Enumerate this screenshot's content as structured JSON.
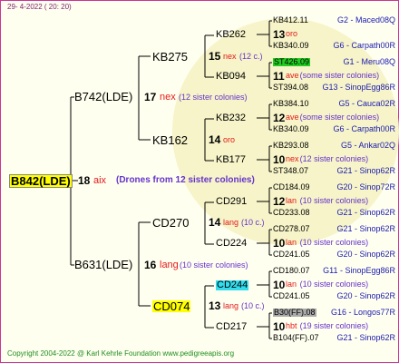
{
  "date": "29-  4-2022 ( 20: 20)",
  "root": {
    "name": "B842(LDE)",
    "num": "18",
    "race": "aix",
    "note": "(Drones from 12 sister colonies)"
  },
  "gen1": [
    {
      "name": "B742(LDE)",
      "num": "17",
      "race": "nex",
      "note": "(12 sister colonies)"
    },
    {
      "name": "B631(LDE)",
      "num": "16",
      "race": "lang",
      "note": "(10 sister colonies)"
    }
  ],
  "gen2": [
    {
      "name": "KB275",
      "num": "15",
      "race": "nex",
      "note": "(12 c.)"
    },
    {
      "name": "KB162",
      "num": "14",
      "race": "oro",
      "note": ""
    },
    {
      "name": "CD270",
      "num": "14",
      "race": "lang",
      "note": "(10 c.)"
    },
    {
      "name": "CD074",
      "num": "13",
      "race": "lang",
      "note": "(10 c.)"
    }
  ],
  "gen3": [
    "KB262",
    "KB094",
    "KB232",
    "KB177",
    "CD291",
    "CD224",
    "CD244",
    "CD217"
  ],
  "leaves": [
    {
      "top": "KB412.11",
      "topInfo": "G2 - Maced08Q",
      "mid": "13",
      "midRace": "oro",
      "midNote": "",
      "bot": "KB340.09",
      "botInfo": "G6 - Carpath00R"
    },
    {
      "top": "ST426.09",
      "topInfo": "G1 - Meru08Q",
      "mid": "11",
      "midRace": "ave",
      "midNote": "(some sister colonies)",
      "bot": "ST394.08",
      "botInfo": "G13 - SinopEgg86R"
    },
    {
      "top": "KB384.10",
      "topInfo": "G5 - Cauca02R",
      "mid": "12",
      "midRace": "ave",
      "midNote": "(some sister colonies)",
      "bot": "KB340.09",
      "botInfo": "G6 - Carpath00R"
    },
    {
      "top": "KB293.08",
      "topInfo": "G5 - Ankar02Q",
      "mid": "10",
      "midRace": "nex",
      "midNote": "(12 sister colonies)",
      "bot": "ST348.07",
      "botInfo": "G21 - Sinop62R"
    },
    {
      "top": "CD184.09",
      "topInfo": "G20 - Sinop72R",
      "mid": "12",
      "midRace": "lan",
      "midNote": "(10 sister colonies)",
      "bot": "CD233.08",
      "botInfo": "G21 - Sinop62R"
    },
    {
      "top": "CD278.07",
      "topInfo": "G21 - Sinop62R",
      "mid": "10",
      "midRace": "lan",
      "midNote": "(10 sister colonies)",
      "bot": "CD241.05",
      "botInfo": "G20 - Sinop62R"
    },
    {
      "top": "CD180.07",
      "topInfo": "G11 - SinopEgg86R",
      "mid": "10",
      "midRace": "lan",
      "midNote": "(10 sister colonies)",
      "bot": "CD241.05",
      "botInfo": "G20 - Sinop62R"
    },
    {
      "top": "B30(FF).08",
      "topInfo": "G16 - Longos77R",
      "mid": "10",
      "midRace": "hbt",
      "midNote": "(19 sister colonies)",
      "bot": "B104(FF).07",
      "botInfo": "G21 - Sinop62R"
    }
  ],
  "copyright": "Copyright 2004-2022 @ Karl Kehrle Foundation    www.pedigreeapis.org",
  "colors": {
    "line": "#000000",
    "frame": "#CC3399",
    "root_highlight": "#FFFF00",
    "cyan_highlight": "#33DDEE",
    "green_highlight": "#22CC22",
    "gray_highlight": "#AAAAAA"
  }
}
